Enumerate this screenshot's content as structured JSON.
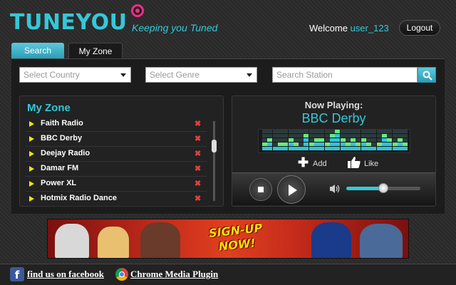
{
  "header": {
    "logo_text": "TUNEYOU",
    "tagline": "Keeping you Tuned",
    "welcome_text": "Welcome",
    "username": "user_123",
    "logout_label": "Logout"
  },
  "tabs": [
    {
      "label": "Search",
      "active": false
    },
    {
      "label": "My Zone",
      "active": true
    }
  ],
  "filters": {
    "country_placeholder": "Select Country",
    "genre_placeholder": "Select Genre",
    "station_placeholder": "Search Station"
  },
  "my_zone": {
    "title": "My Zone",
    "stations": [
      {
        "name": "Faith Radio"
      },
      {
        "name": "BBC Derby"
      },
      {
        "name": "Deejay Radio"
      },
      {
        "name": "Damar FM"
      },
      {
        "name": "Power XL"
      },
      {
        "name": "Hotmix Radio Dance"
      }
    ],
    "remove_glyph": "✖"
  },
  "now_playing": {
    "label": "Now Playing:",
    "station": "BBC Derby",
    "add_label": "Add",
    "like_label": "Like",
    "volume": 0.5,
    "equalizer_levels": [
      2,
      3,
      1,
      2,
      2,
      3,
      2,
      1,
      4,
      2,
      3,
      3,
      2,
      4,
      5,
      3,
      2,
      3,
      2,
      3,
      2,
      1,
      2,
      4,
      3,
      2,
      3,
      2
    ],
    "colors": {
      "eq_active": "#2ec4d8",
      "eq_peak": "#6ee87a",
      "eq_off": "#2c3a3c"
    }
  },
  "banner": {
    "line1": "SIGN-UP",
    "line2": "NOW!"
  },
  "footer": {
    "facebook_label": "find us on facebook",
    "chrome_label": "Chrome Media Plugin"
  },
  "colors": {
    "accent": "#34c8d8",
    "brand_pink": "#ff2a8a",
    "arrow_yellow": "#f0e800",
    "remove_red": "#e04040"
  }
}
